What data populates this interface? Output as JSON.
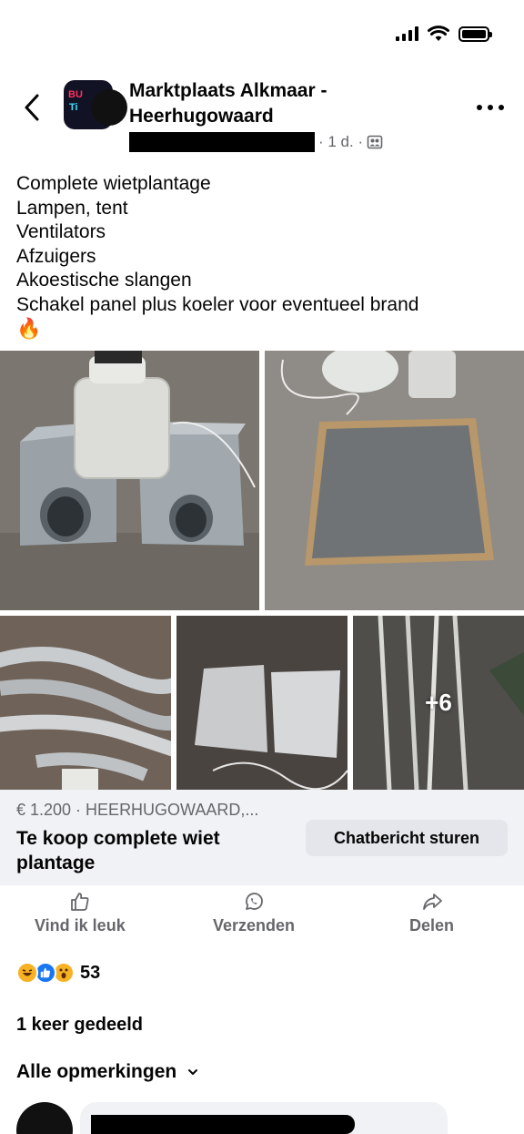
{
  "status_bar": {
    "signal": "signal-icon",
    "wifi": "wifi-icon",
    "battery": "battery-icon"
  },
  "header": {
    "back_icon": "back-chevron-icon",
    "group_name": "Marktplaats Alkmaar - Heerhugowaard",
    "time": "· 1 d. ·",
    "privacy_icon": "group-members-icon",
    "more_icon": "more-options-icon"
  },
  "post": {
    "lines": [
      "Complete wietplantage",
      "Lampen, tent",
      "Ventilators",
      "Afzuigers",
      "Akoestische slangen",
      "Schakel panel plus koeler voor eventueel brand",
      "🔥"
    ]
  },
  "photos": {
    "more_count": "+6"
  },
  "listing": {
    "meta": "€ 1.200 · HEERHUGOWAARD,...",
    "title": "Te koop complete wiet plantage",
    "chat_button": "Chatbericht sturen"
  },
  "actions": {
    "like": "Vind ik leuk",
    "send": "Verzenden",
    "share": "Delen"
  },
  "reactions": {
    "count": "53",
    "types": [
      "haha",
      "like",
      "wow"
    ]
  },
  "shares": "1 keer gedeeld",
  "comments": {
    "sort_label": "Alle opmerkingen"
  },
  "colors": {
    "secondary_text": "#65676b",
    "card_bg": "#f0f2f5",
    "button_bg": "#e4e6eb",
    "like_blue": "#1877f2"
  }
}
